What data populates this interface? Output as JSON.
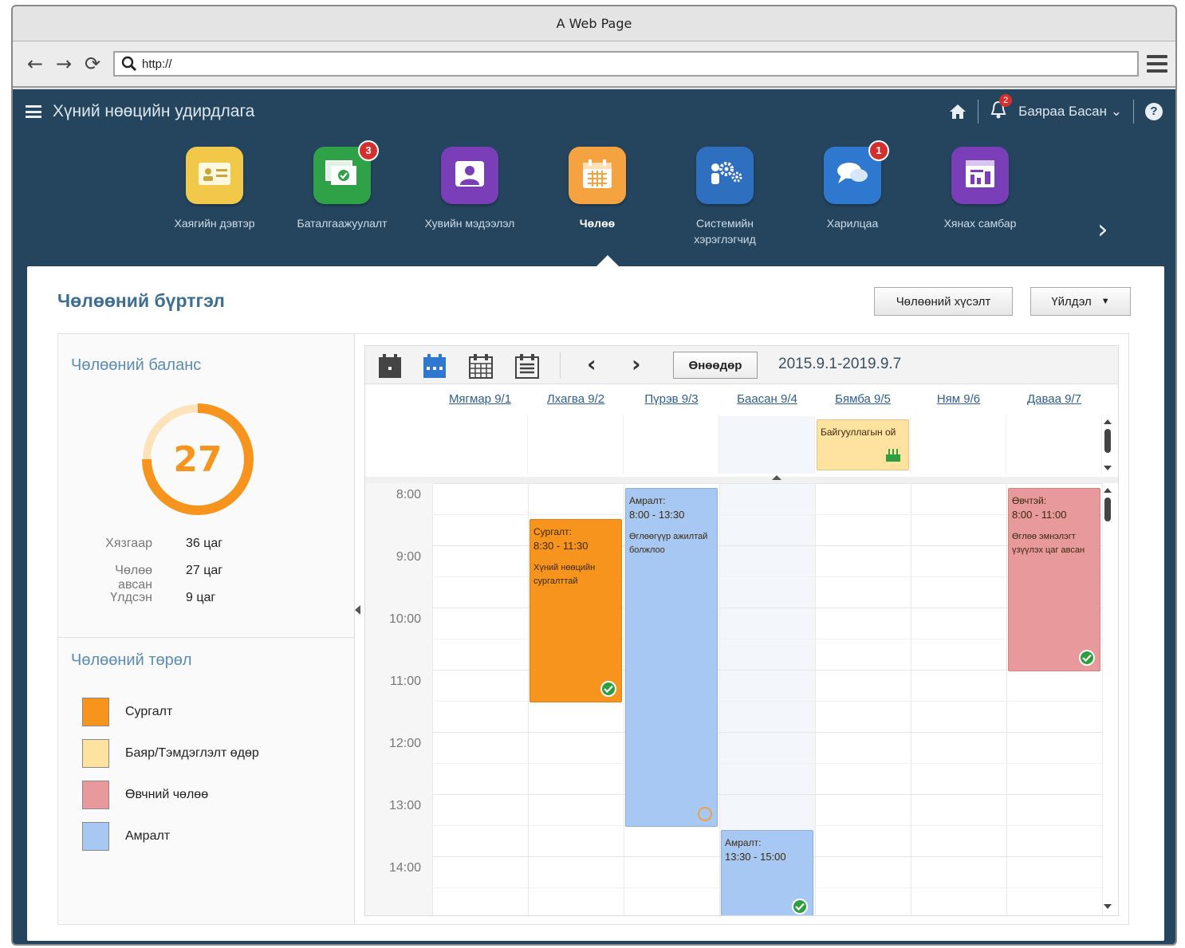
{
  "browser": {
    "title": "A Web Page",
    "url": "http://"
  },
  "app": {
    "title": "Хүний нөөцийн удирдлага",
    "notifications": "2",
    "user": "Баярaa Басан"
  },
  "modules": [
    {
      "label": "Хаягийн дэвтэр",
      "icon": "address-book-icon",
      "color": "#f2c84b",
      "badge": ""
    },
    {
      "label": "Баталгаажуулалт",
      "icon": "approval-icon",
      "color": "#2fa247",
      "badge": "3"
    },
    {
      "label": "Хувийн мэдээлэл",
      "icon": "profile-icon",
      "color": "#7a3fb8",
      "badge": ""
    },
    {
      "label": "Чөлөө",
      "icon": "calendar-icon",
      "color": "#f5a341",
      "badge": ""
    },
    {
      "label": "Системийн\nхэрэглэгчид",
      "icon": "system-users-icon",
      "color": "#2f6fc0",
      "badge": ""
    },
    {
      "label": "Харилцаа",
      "icon": "chat-icon",
      "color": "#2f78d0",
      "badge": "1"
    },
    {
      "label": "Хянах самбар",
      "icon": "dashboard-icon",
      "color": "#7a3fb8",
      "badge": ""
    }
  ],
  "page": {
    "title": "Чөлөөний бүртгэл",
    "request_button": "Чөлөөний хүсэлт",
    "action_button": "Үйлдэл"
  },
  "balance": {
    "title": "Чөлөөний баланс",
    "value": "27",
    "used_fraction": 0.75,
    "rows": [
      {
        "label": "Хязгаар",
        "value": "36 цаг"
      },
      {
        "label": "Чөлөө авсан",
        "value": "27 цаг"
      },
      {
        "label": "Үлдсэн",
        "value": "9 цаг"
      }
    ]
  },
  "types": {
    "title": "Чөлөөний төрөл",
    "items": [
      {
        "label": "Сургалт",
        "color": "#f7941d"
      },
      {
        "label": "Баяр/Тэмдэглэлт өдөр",
        "color": "#fde2a0"
      },
      {
        "label": "Өвчний чөлөө",
        "color": "#e8999b"
      },
      {
        "label": "Амралт",
        "color": "#a8c8f4"
      }
    ]
  },
  "calendar": {
    "today_button": "Өнөөдөр",
    "range": "2015.9.1-2019.9.7",
    "days": [
      "Мягмар 9/1",
      "Лхагва 9/2",
      "Пүрэв 9/3",
      "Баасан 9/4",
      "Бямба 9/5",
      "Ням 9/6",
      "Даваа 9/7"
    ],
    "hours": [
      "8:00",
      "9:00",
      "10:00",
      "11:00",
      "12:00",
      "13:00",
      "14:00"
    ],
    "allday_event": {
      "title": "Байгууллагын ой",
      "day": 4
    },
    "events": [
      {
        "day": 1,
        "start": 8.5,
        "end": 11.5,
        "title": "Сургалт:",
        "time": "8:30 - 11:30",
        "desc": "Хүний нөөцийн сургалттай",
        "color": "#f7941d",
        "status": "approved"
      },
      {
        "day": 2,
        "start": 8.0,
        "end": 13.5,
        "title": "Амралт:",
        "time": "8:00 - 13:30",
        "desc": "Өглөөгүүр ажилтай болжлоо",
        "color": "#a8c8f4",
        "status": "pending"
      },
      {
        "day": 3,
        "start": 13.5,
        "end": 15.0,
        "title": "Амралт:",
        "time": "13:30 - 15:00",
        "desc": "",
        "color": "#a8c8f4",
        "status": "approved"
      },
      {
        "day": 6,
        "start": 8.0,
        "end": 11.0,
        "title": "Өвчтэй:",
        "time": "8:00 - 11:00",
        "desc": "Өглөө эмнэлэгт үзүүлэх цаг авсан",
        "color": "#e8999b",
        "status": "approved"
      }
    ]
  }
}
